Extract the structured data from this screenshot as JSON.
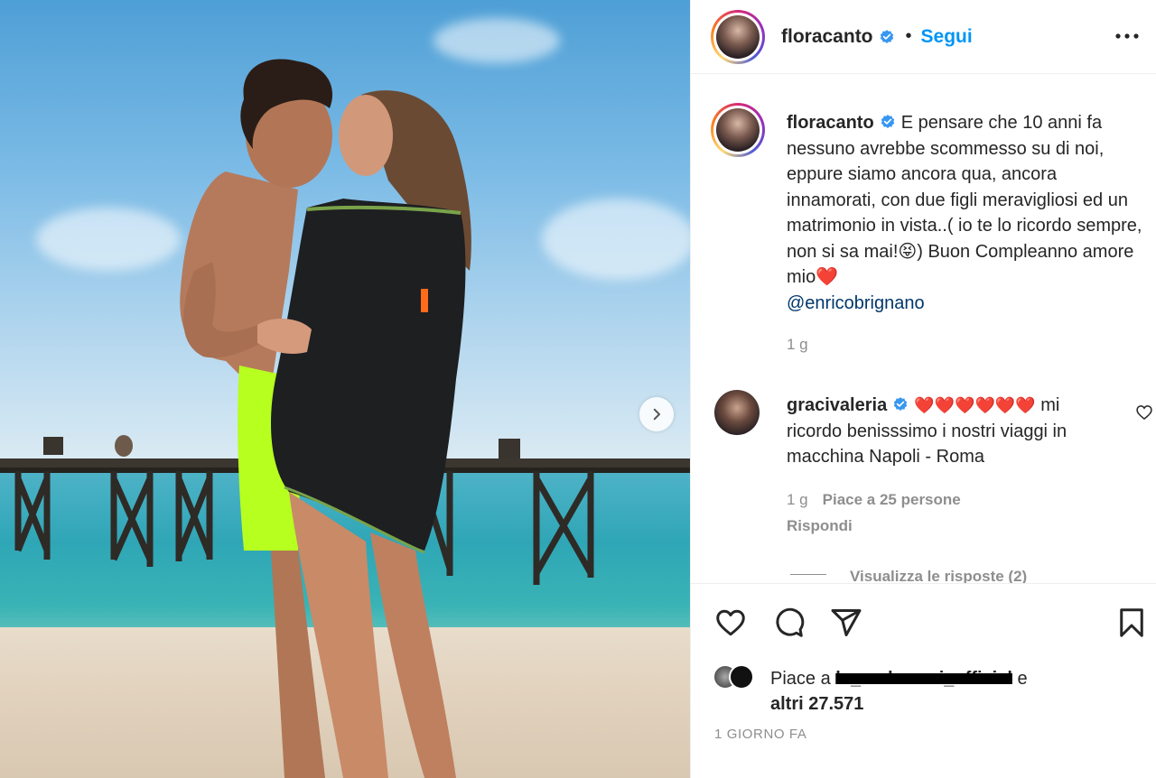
{
  "post": {
    "account": "floracanto",
    "follow_label": "Segui",
    "separator": "•"
  },
  "caption": {
    "username": "floracanto",
    "text": "E pensare che 10 anni fa nessuno avrebbe scommesso su di noi, eppure siamo ancora qua, ancora innamorati, con due figli meravigliosi ed un matrimonio in vista..( io te lo ricordo sempre, non si sa mai!😝) Buon Compleanno amore mio❤️",
    "mention": "@enricobrignano",
    "age": "1 g"
  },
  "comment": {
    "username": "gracivaleria",
    "hearts": "❤️❤️❤️❤️❤️❤️",
    "text": " mi ricordo benisssimo i nostri viaggi in macchina Napoli - Roma",
    "age": "1 g",
    "likes": "Piace a 25 persone",
    "reply_label": "Rispondi",
    "view_replies": "Visualizza le risposte (2)"
  },
  "likes": {
    "prefix": "Piace a ",
    "user": "le_andreozzi_official",
    "suffix": " e",
    "others": "altri 27.571"
  },
  "date": "1 GIORNO FA",
  "colors": {
    "link_blue": "#0095f6",
    "mention_blue": "#00376b",
    "secondary_text": "#8e8e8e",
    "divider": "#efefef"
  },
  "icons": [
    "verified-badge-icon",
    "more-options-icon",
    "chevron-right-icon",
    "heart-icon",
    "comment-icon",
    "share-icon",
    "bookmark-icon"
  ]
}
